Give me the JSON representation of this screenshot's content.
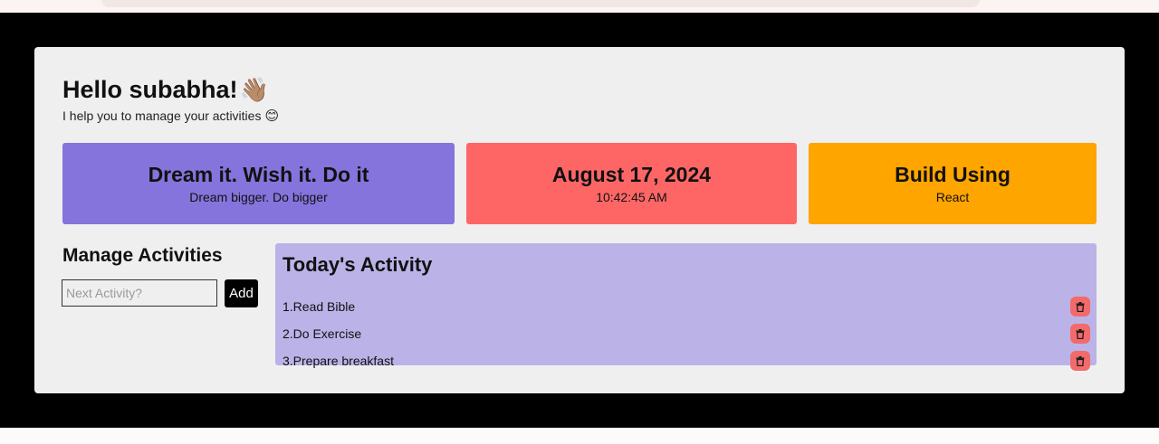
{
  "header": {
    "greeting": "Hello subabha!",
    "wave_emoji": "👋🏽",
    "tagline": "I help you to manage your activities",
    "smile_emoji": "😊"
  },
  "cards": [
    {
      "title": "Dream it. Wish it. Do it",
      "subtitle": "Dream bigger. Do bigger",
      "color": "#8474dc"
    },
    {
      "title": "August 17, 2024",
      "subtitle": "10:42:45 AM",
      "color": "#fe6666"
    },
    {
      "title": "Build Using",
      "subtitle": "React",
      "color": "#ffa500"
    }
  ],
  "manage": {
    "title": "Manage Activities",
    "input_placeholder": "Next Activity?",
    "input_value": "",
    "add_label": "Add"
  },
  "today": {
    "title": "Today's Activity",
    "items": [
      {
        "label": "1.Read Bible",
        "icon": "trash-icon"
      },
      {
        "label": "2.Do Exercise",
        "icon": "trash-icon"
      },
      {
        "label": "3.Prepare breakfast",
        "icon": "trash-icon"
      }
    ]
  }
}
